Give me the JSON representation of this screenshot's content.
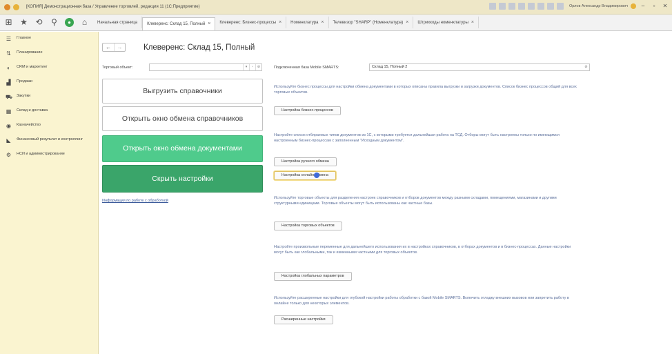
{
  "titlebar": {
    "title": "[КОПИЯ] Демонстрационная база / Управление торговлей, редакция 11 (1С:Предприятие)",
    "user": "Орлов Александр Владимирович"
  },
  "tabs": [
    {
      "label": "Начальная страница",
      "closable": false,
      "active": false
    },
    {
      "label": "Клеверенс: Склад 15, Полный",
      "closable": true,
      "active": true
    },
    {
      "label": "Клеверенс: Бизнес-процессы",
      "closable": true,
      "active": false
    },
    {
      "label": "Номенклатура",
      "closable": true,
      "active": false
    },
    {
      "label": "Телевизор \"SHARP\" (Номенклатура)",
      "closable": true,
      "active": false
    },
    {
      "label": "Штрихкоды номенклатуры",
      "closable": true,
      "active": false
    }
  ],
  "sidebar": {
    "items": [
      {
        "label": "Главное",
        "icon": "menu-icon"
      },
      {
        "label": "Планирование",
        "icon": "planning-icon"
      },
      {
        "label": "CRM и маркетинг",
        "icon": "crm-icon"
      },
      {
        "label": "Продажи",
        "icon": "sales-icon"
      },
      {
        "label": "Закупки",
        "icon": "cart-icon"
      },
      {
        "label": "Склад и доставка",
        "icon": "warehouse-icon"
      },
      {
        "label": "Казначейство",
        "icon": "treasury-icon"
      },
      {
        "label": "Финансовый результат и контроллинг",
        "icon": "finance-icon"
      },
      {
        "label": "НСИ и администрирование",
        "icon": "settings-icon"
      }
    ]
  },
  "page": {
    "title": "Клеверенс: Склад 15, Полный",
    "trade_object_label": "Торговый объект:",
    "trade_object_value": "",
    "db_label": "Подключенная база Mobile SMARTS:",
    "db_value": "Склад 15, Полный 2",
    "left_buttons": [
      {
        "label": "Выгрузить справочники"
      },
      {
        "label": "Открыть окно обмена справочников"
      },
      {
        "label": "Открыть окно обмена документами"
      },
      {
        "label": "Скрыть настройки"
      }
    ],
    "info_link": "Информация по работе с обработкой",
    "sections": [
      {
        "text": "Используйте бизнес процессы для настройки обмена документами в которых описаны правила выгрузки и загрузки документов. Список бизнес процессов общий для всех торговых объектов.",
        "button": "Настройка бизнес-процессов"
      },
      {
        "text": "Настройте список отбираемых типов документов из 1С, с которыми требуется дальнейшая работа на ТСД. Отборы могут быть настроены только по имеющимся настроенным бизнес-процессам с заполненным \"Исходным документом\".",
        "button": "Настройка ручного обмена",
        "button2": "Настройка онлайн-обмена"
      },
      {
        "text": "Используйте торговые объекты для разделения настроек справочников и отборов документов между разными складами, помещениями, магазинами и другими структурными единицами. Торговые объекты могут быть использованы как частные базы.",
        "button": "Настройка торговых объектов"
      },
      {
        "text": "Настройте произвольные переменные для дальнейшего использования их в настройках справочников, в отборах документов и в бизнес-процессах. Данные настройки могут быть как глобальными, так и изменными частными для торговых объектов.",
        "button": "Настройка глобальных параметров"
      },
      {
        "text": "Используйте расширенные настройки для глубокой настройки работы обработки с базой Mobile SMARTS. Включить отладку внешних вызовов или запретить работу в онлайне только для некоторых элементов.",
        "button": "Расширенные настройки"
      }
    ]
  }
}
